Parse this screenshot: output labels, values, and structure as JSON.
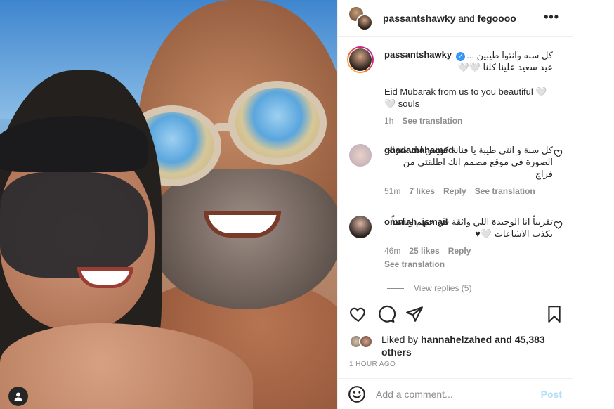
{
  "header": {
    "user1": "passantshawky",
    "joiner": "and",
    "user2": "fegoooo",
    "more_icon": "more-horizontal-icon"
  },
  "caption": {
    "username": "passantshawky",
    "verified": true,
    "line_ar1": "كل سنه وانتوا طيبين ...",
    "line_ar2": "عيد سعيد علينا كلنا 🤍🤍",
    "line_en": "Eid Mubarak from us to you beautiful 🤍🤍 souls",
    "time": "1h",
    "see_translation": "See translation"
  },
  "comments": [
    {
      "username": "ghadamahamed",
      "text": "كل سنة و انتى طيبة يا فنانة كويس انك منزلة الصورة فى موقع مصمم انك اطلقتى من فراج",
      "time": "51m",
      "likes": "7 likes",
      "reply": "Reply",
      "see_translation": "See translation"
    },
    {
      "username": "omniah_ismail",
      "text": "تقريباً انا الوحيدة اللي واثقة في حبهم ودايماً بكذب الاشاعات 🤍♥",
      "time": "46m",
      "likes": "25 likes",
      "reply": "Reply",
      "see_translation": "See translation"
    }
  ],
  "view_replies": "View replies (5)",
  "actions": {
    "like_icon": "heart-icon",
    "comment_icon": "comment-icon",
    "share_icon": "share-icon",
    "save_icon": "bookmark-icon"
  },
  "likes": {
    "prefix": "Liked by",
    "user": "hannahelzahed",
    "suffix": "and 45,383 others"
  },
  "post_time": "1 HOUR AGO",
  "add_comment": {
    "placeholder": "Add a comment...",
    "post_label": "Post"
  },
  "colors": {
    "verified": "#3897f0",
    "post_disabled": "#b2dffc",
    "muted": "#8e8e8e"
  }
}
